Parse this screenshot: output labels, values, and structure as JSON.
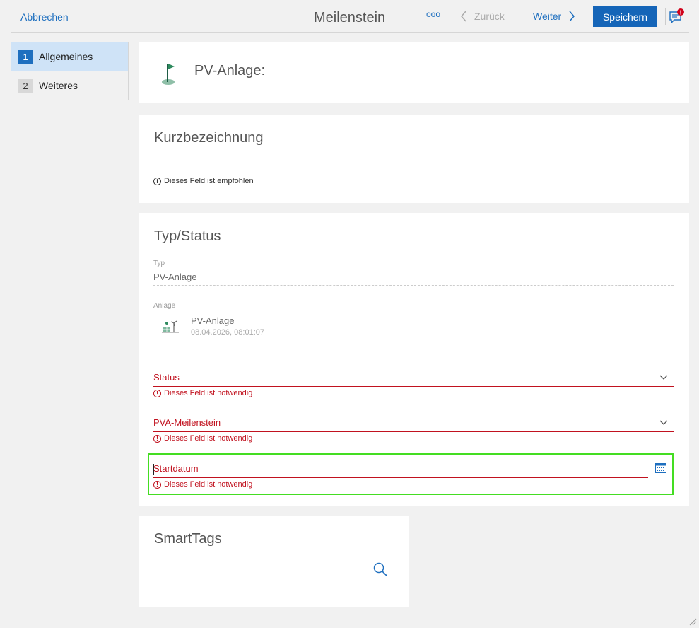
{
  "toolbar": {
    "cancel_label": "Abbrechen",
    "title": "Meilenstein",
    "more_label": "ooo",
    "back_label": "Zurück",
    "next_label": "Weiter",
    "save_label": "Speichern",
    "notification_badge": "!"
  },
  "sidebar": {
    "items": [
      {
        "num": "1",
        "label": "Allgemeines",
        "active": true
      },
      {
        "num": "2",
        "label": "Weiteres",
        "active": false
      }
    ]
  },
  "header_card": {
    "title": "PV-Anlage:",
    "icon": "flag-icon"
  },
  "kurz_card": {
    "title": "Kurzbezeichnung",
    "value": "",
    "hint": "Dieses Feld ist empfohlen"
  },
  "typ_card": {
    "title": "Typ/Status",
    "typ_label": "Typ",
    "typ_value": "PV-Anlage",
    "anlage_label": "Anlage",
    "anlage_name": "PV-Anlage",
    "anlage_date": "08.04.2026, 08:01:07",
    "status_label": "Status",
    "status_hint": "Dieses Feld ist notwendig",
    "milestone_label": "PVA-Meilenstein",
    "milestone_hint": "Dieses Feld ist notwendig",
    "start_label": "Startdatum",
    "start_hint": "Dieses Feld ist notwendig"
  },
  "tags_card": {
    "title": "SmartTags",
    "value": ""
  },
  "colors": {
    "accent": "#1e6fbf",
    "error": "#c1121f",
    "focus": "#44dd22",
    "save_bg": "#1565b8"
  }
}
